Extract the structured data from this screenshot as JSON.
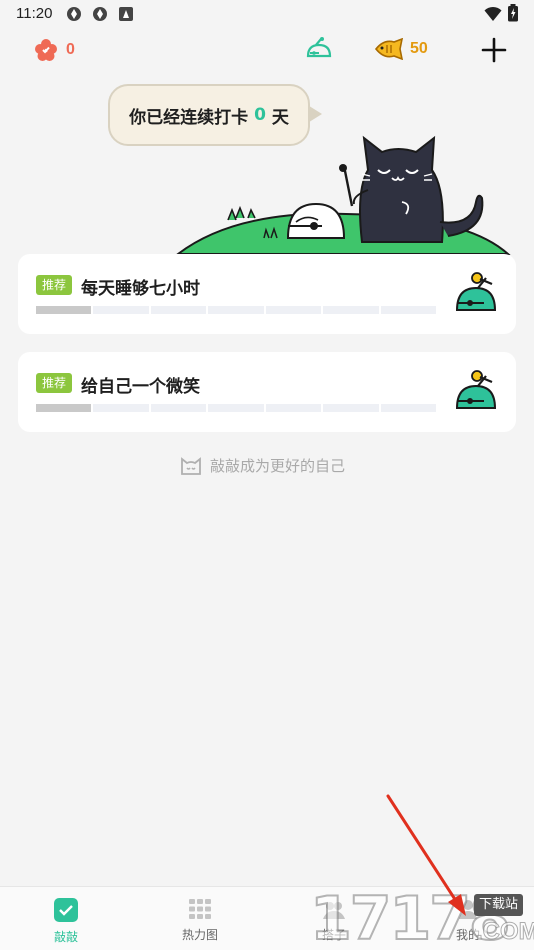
{
  "status_bar": {
    "time": "11:20"
  },
  "topbar": {
    "flower_count": "0",
    "fish_count": "50"
  },
  "greeting": {
    "prefix": "你已经连续打卡",
    "days": "0",
    "suffix": "天"
  },
  "cards": [
    {
      "tag": "推荐",
      "title": "每天睡够七小时",
      "progress": 0.14,
      "icon": "knock-bell-icon"
    },
    {
      "tag": "推荐",
      "title": "给自己一个微笑",
      "progress": 0.14,
      "icon": "knock-bell-icon"
    }
  ],
  "motto": "敲敲成为更好的自己",
  "nav": [
    {
      "label": "敲敲",
      "icon": "check-square-icon"
    },
    {
      "label": "热力图",
      "icon": "grid-icon"
    },
    {
      "label": "搭子",
      "icon": "partner-icon"
    },
    {
      "label": "我的",
      "icon": "profile-icon"
    }
  ],
  "watermark": {
    "digits": "17178",
    "site": "下载站",
    "com": ".COM"
  },
  "colors": {
    "accent": "#2ec29a",
    "flower": "#ef6a55",
    "fish": "#e39a10",
    "tag": "#8cc63e"
  }
}
